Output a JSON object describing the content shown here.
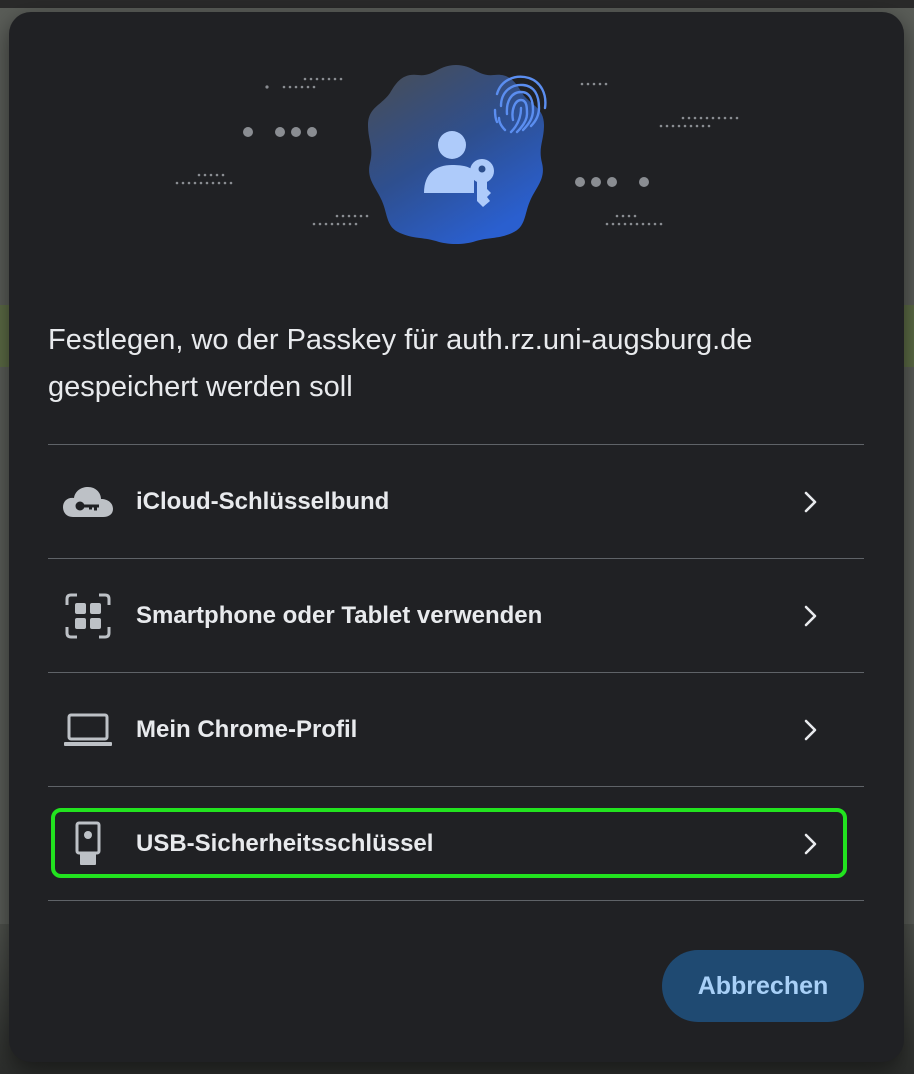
{
  "dialog": {
    "title": "Festlegen, wo der Passkey für auth.rz.uni-augsburg.de gespeichert werden soll",
    "options": [
      {
        "label": "iCloud-Schlüsselbund",
        "icon": "cloud-key-icon"
      },
      {
        "label": "Smartphone oder Tablet verwenden",
        "icon": "qr-code-icon"
      },
      {
        "label": "Mein Chrome-Profil",
        "icon": "laptop-icon"
      },
      {
        "label": "USB-Sicherheitsschlüssel",
        "icon": "usb-key-icon",
        "highlighted": true
      }
    ],
    "cancel_label": "Abbrechen"
  },
  "colors": {
    "dialog_bg": "#202124",
    "text": "#e8eaed",
    "button_bg": "#1f4a72",
    "button_text": "#a8d0f7",
    "highlight": "#22e31f",
    "accent": "#8ab4f8"
  }
}
